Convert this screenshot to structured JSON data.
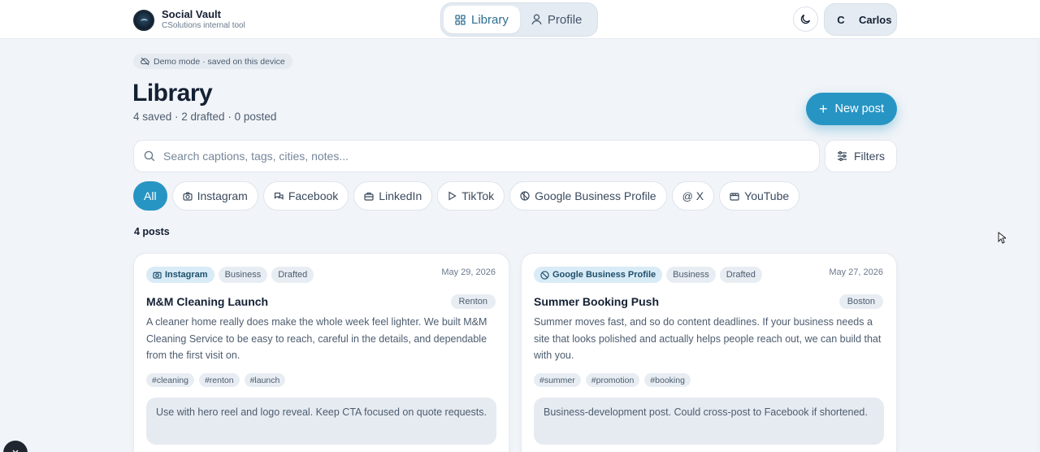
{
  "brand": {
    "title": "Social Vault",
    "subtitle": "CSolutions internal tool"
  },
  "nav": {
    "items": [
      {
        "label": "Library",
        "icon": "grid-icon",
        "active": true
      },
      {
        "label": "Profile",
        "icon": "user-icon",
        "active": false
      }
    ]
  },
  "user": {
    "initial": "C",
    "name": "Carlos"
  },
  "demo_badge": "Demo mode · saved on this device",
  "page": {
    "title": "Library",
    "stats": "4 saved · 2 drafted · 0 posted"
  },
  "new_post_label": "New post",
  "search": {
    "placeholder": "Search captions, tags, cities, notes..."
  },
  "filters_label": "Filters",
  "chips": [
    {
      "label": "All",
      "active": true
    },
    {
      "label": "Instagram",
      "icon": "camera-icon"
    },
    {
      "label": "Facebook",
      "icon": "chat-icon"
    },
    {
      "label": "LinkedIn",
      "icon": "briefcase-icon"
    },
    {
      "label": "TikTok",
      "icon": "play-icon"
    },
    {
      "label": "Google Business Profile",
      "icon": "globe-icon"
    },
    {
      "label": "X",
      "icon": "at-icon"
    },
    {
      "label": "YouTube",
      "icon": "video-icon"
    }
  ],
  "count_label": "4 posts",
  "posts": [
    {
      "platform": "Instagram",
      "category": "Business",
      "status": "Drafted",
      "date": "May 29, 2026",
      "title": "M&M Cleaning Launch",
      "city": "Renton",
      "body": "A cleaner home really does make the whole week feel lighter. We built M&M Cleaning Service to be easy to reach, careful in the details, and dependable from the first visit on.",
      "hashtags": [
        "#cleaning",
        "#renton",
        "#launch"
      ],
      "note": "Use with hero reel and logo reveal. Keep CTA focused on quote requests."
    },
    {
      "platform": "Google Business Profile",
      "category": "Business",
      "status": "Drafted",
      "date": "May 27, 2026",
      "title": "Summer Booking Push",
      "city": "Boston",
      "body": "Summer moves fast, and so do content deadlines. If your business needs a site that looks polished and actually helps people reach out, we can build that with you.",
      "hashtags": [
        "#summer",
        "#promotion",
        "#booking"
      ],
      "note": "Business-development post. Could cross-post to Facebook if shortened."
    }
  ],
  "colors": {
    "accent": "#2795c4",
    "background": "#f1f4f8",
    "card": "#ffffff"
  }
}
